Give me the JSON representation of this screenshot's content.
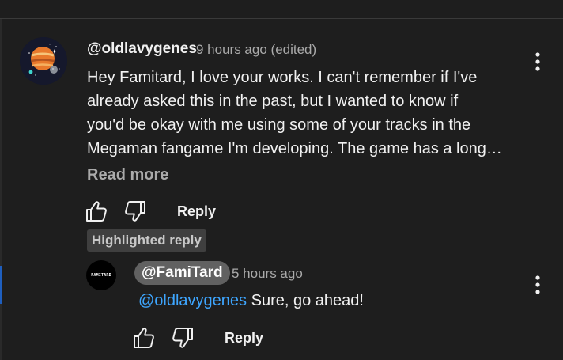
{
  "comment": {
    "author": "@oldlavygenes",
    "timestamp": "9 hours ago",
    "edited": "(edited)",
    "body_lines": [
      "Hey Famitard, I love your works. I can't remember if I've",
      "already asked this in the past, but I wanted to know if",
      "you'd be okay with me using some of your tracks in the",
      "Megaman fangame I'm developing. The game has a long…"
    ],
    "read_more": "Read more",
    "reply_label": "Reply",
    "highlight_badge": "Highlighted reply"
  },
  "reply": {
    "avatar_text": "FAMITARD",
    "author": "@FamiTard",
    "timestamp": "5 hours ago",
    "mention": "@oldlavygenes",
    "text": "Sure, go ahead!",
    "reply_label": "Reply"
  },
  "colors": {
    "background": "#1e1e1e",
    "text": "#f1f1f1",
    "secondary": "#aaaaaa",
    "mention": "#3ea6ff",
    "pill": "#616161",
    "badge": "#3f3f3f"
  },
  "icons": {
    "like": "thumbs-up-icon",
    "dislike": "thumbs-down-icon",
    "menu": "kebab-menu-icon"
  }
}
